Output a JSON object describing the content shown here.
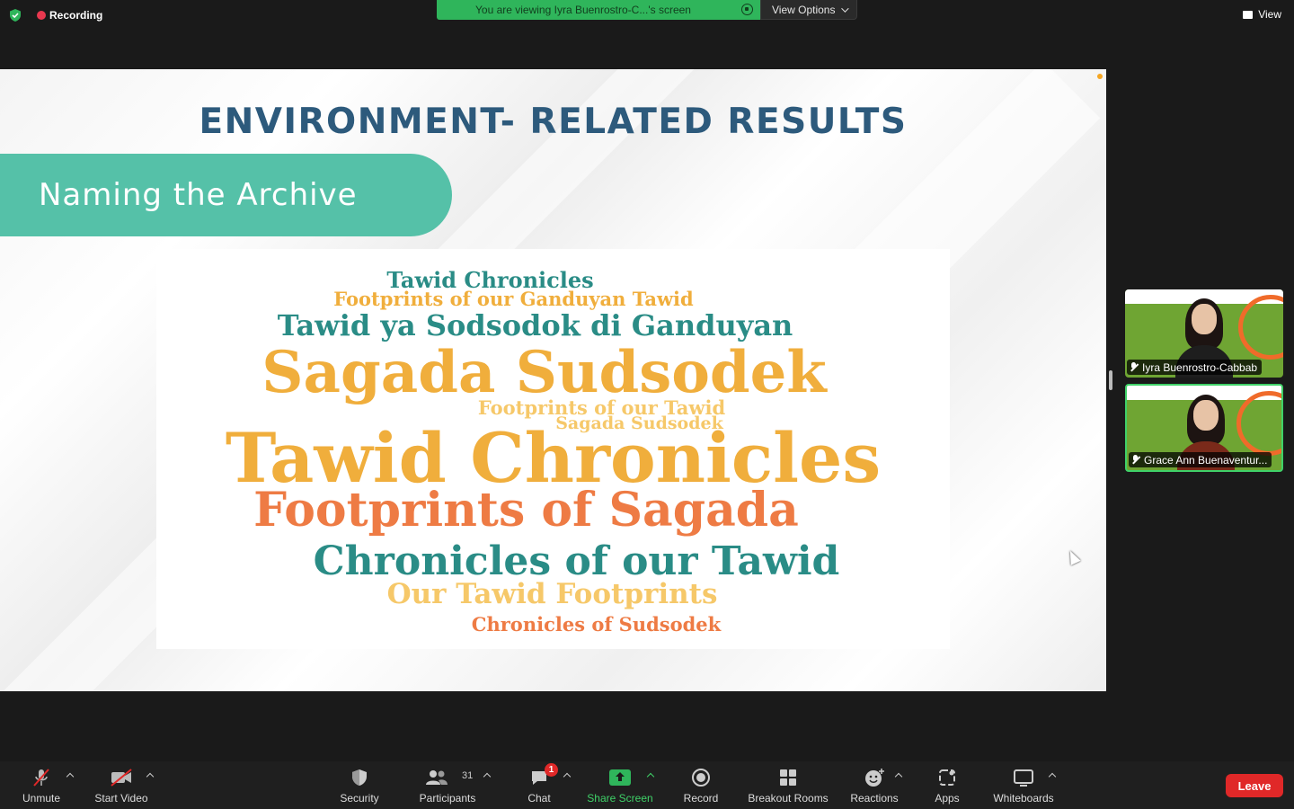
{
  "topbar": {
    "recording_label": "Recording",
    "viewing_text": "You are viewing Iyra Buenrostro-C...'s screen",
    "view_options_label": "View Options",
    "view_label": "View"
  },
  "slide": {
    "title": "ENVIRONMENT- RELATED RESULTS",
    "section_label": "Naming the Archive",
    "word_cloud": [
      "Tawid Chronicles",
      "Footprints of our Ganduyan Tawid",
      "Tawid ya Sodsodok di Ganduyan",
      "Sagada Sudsodek",
      "Footprints of our Tawid",
      "Sagada Sudsodek",
      "Tawid Chronicles",
      "Footprints of Sagada",
      "Chronicles of our Tawid",
      "Our Tawid Footprints",
      "Chronicles of Sudsodek"
    ]
  },
  "participants": [
    {
      "name": "Iyra Buenrostro-Cabbab"
    },
    {
      "name": "Grace Ann Buenaventur..."
    }
  ],
  "toolbar": {
    "unmute": "Unmute",
    "start_video": "Start Video",
    "security": "Security",
    "participants": "Participants",
    "participants_count": "31",
    "chat": "Chat",
    "chat_badge": "1",
    "share_screen": "Share Screen",
    "record": "Record",
    "breakout_rooms": "Breakout Rooms",
    "reactions": "Reactions",
    "apps": "Apps",
    "whiteboards": "Whiteboards",
    "leave": "Leave"
  },
  "colors": {
    "share_green": "#2fb55b",
    "title_blue": "#2d5a7c",
    "pill_teal": "#55c1a8",
    "leave_red": "#e02828"
  }
}
